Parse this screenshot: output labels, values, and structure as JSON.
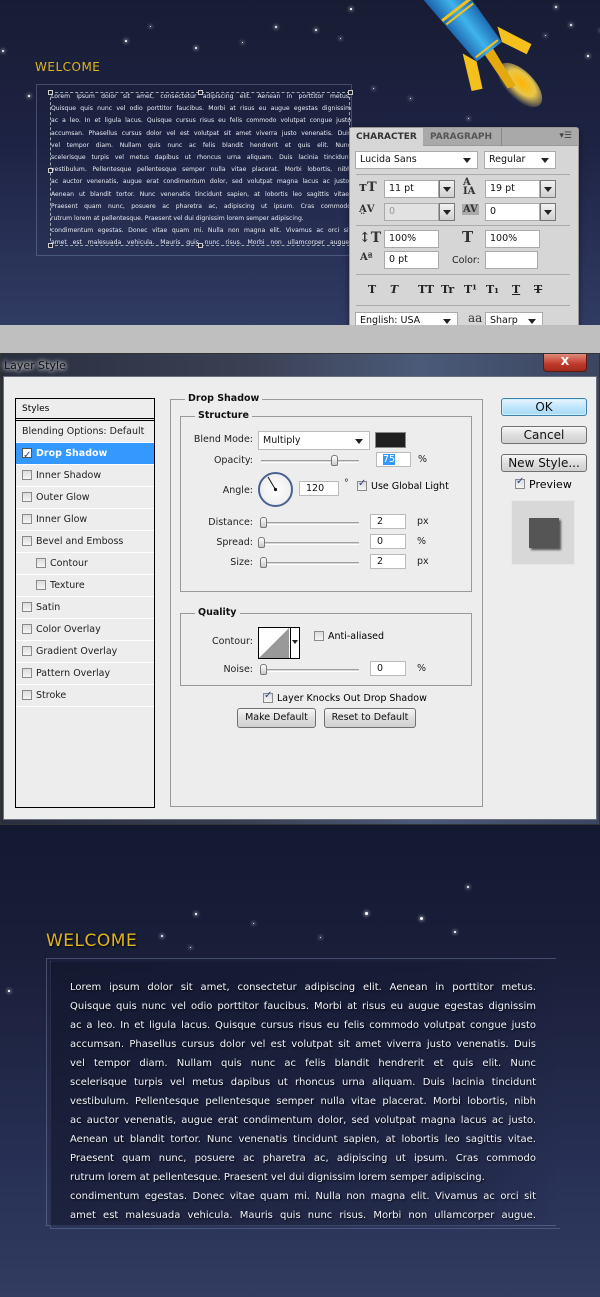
{
  "colors": {
    "welcome_gold": "#e0b321",
    "selection_blue": "#3399ff",
    "shadow_color": "#1f1f1f"
  },
  "top_preview": {
    "heading": "WELCOME",
    "paragraph_lines": [
      "Lorem ipsum dolor sit amet, consectetur adipiscing elit. Aenean in porttitor metus.",
      "Quisque quis nunc vel odio porttitor faucibus. Morbi at risus eu augue egestas dignissim",
      "ac a leo. In et ligula lacus. Quisque cursus risus eu felis commodo volutpat congue justo",
      "accumsan. Phasellus cursus dolor vel est volutpat sit amet viverra justo venenatis. Duis",
      "vel tempor diam. Nullam quis nunc ac felis blandit hendrerit et quis elit. Nunc",
      "scelerisque turpis vel metus dapibus ut rhoncus urna aliquam. Duis lacinia tincidunt",
      "vestibulum. Pellentesque pellentesque semper nulla vitae placerat. Morbi lobortis, nibh",
      "ac auctor venenatis, augue erat condimentum dolor, sed volutpat magna lacus ac justo.",
      "Aenean ut blandit tortor. Nunc venenatis tincidunt sapien, at lobortis leo sagittis vitae.",
      "Praesent quam nunc, posuere ac pharetra ac, adipiscing ut ipsum. Cras commodo",
      "rutrum lorem at pellentesque. Praesent vel dui dignissim lorem semper adipiscing.",
      "condimentum egestas. Donec vitae quam mi. Nulla non magna elit. Vivamus ac orci sit",
      "amet est malesuada vehicula. Mauris quis nunc risus. Morbi non ullamcorper augue."
    ]
  },
  "character_panel": {
    "tabs": [
      "CHARACTER",
      "PARAGRAPH"
    ],
    "menu_icon": "panel-menu-icon",
    "font_family": "Lucida Sans",
    "font_style": "Regular",
    "font_size": "11 pt",
    "leading": "19 pt",
    "kerning": "0",
    "tracking": "0",
    "vertical_scale": "100%",
    "horizontal_scale": "100%",
    "baseline_shift": "0 pt",
    "color_label": "Color:",
    "style_buttons": [
      "T",
      "T",
      "TT",
      "Tr",
      "T¹",
      "T₁",
      "T",
      "T"
    ],
    "language": "English: USA",
    "antialias_icon": "aa",
    "antialias": "Sharp"
  },
  "dialog": {
    "title": "Layer Style",
    "close_label": "X",
    "styles_header": "Styles",
    "styles": [
      {
        "label": "Blending Options: Default",
        "checkbox": false,
        "checked": false,
        "selected": false,
        "indent": false
      },
      {
        "label": "Drop Shadow",
        "checkbox": true,
        "checked": true,
        "selected": true,
        "indent": false
      },
      {
        "label": "Inner Shadow",
        "checkbox": true,
        "checked": false,
        "selected": false,
        "indent": false
      },
      {
        "label": "Outer Glow",
        "checkbox": true,
        "checked": false,
        "selected": false,
        "indent": false
      },
      {
        "label": "Inner Glow",
        "checkbox": true,
        "checked": false,
        "selected": false,
        "indent": false
      },
      {
        "label": "Bevel and Emboss",
        "checkbox": true,
        "checked": false,
        "selected": false,
        "indent": false
      },
      {
        "label": "Contour",
        "checkbox": true,
        "checked": false,
        "selected": false,
        "indent": true
      },
      {
        "label": "Texture",
        "checkbox": true,
        "checked": false,
        "selected": false,
        "indent": true
      },
      {
        "label": "Satin",
        "checkbox": true,
        "checked": false,
        "selected": false,
        "indent": false
      },
      {
        "label": "Color Overlay",
        "checkbox": true,
        "checked": false,
        "selected": false,
        "indent": false
      },
      {
        "label": "Gradient Overlay",
        "checkbox": true,
        "checked": false,
        "selected": false,
        "indent": false
      },
      {
        "label": "Pattern Overlay",
        "checkbox": true,
        "checked": false,
        "selected": false,
        "indent": false
      },
      {
        "label": "Stroke",
        "checkbox": true,
        "checked": false,
        "selected": false,
        "indent": false
      }
    ],
    "drop_shadow": {
      "section_title": "Drop Shadow",
      "structure_title": "Structure",
      "blend_mode_label": "Blend Mode:",
      "blend_mode": "Multiply",
      "opacity_label": "Opacity:",
      "opacity": "75",
      "opacity_unit": "%",
      "opacity_slider_fraction": 0.75,
      "angle_label": "Angle:",
      "angle": "120",
      "angle_unit": "°",
      "use_global_light_label": "Use Global Light",
      "use_global_light": true,
      "distance_label": "Distance:",
      "distance": "2",
      "distance_unit": "px",
      "spread_label": "Spread:",
      "spread": "0",
      "spread_unit": "%",
      "size_label": "Size:",
      "size": "2",
      "size_unit": "px",
      "quality_title": "Quality",
      "contour_label": "Contour:",
      "anti_aliased_label": "Anti-aliased",
      "anti_aliased": false,
      "noise_label": "Noise:",
      "noise": "0",
      "noise_unit": "%",
      "knockout_label": "Layer Knocks Out Drop Shadow",
      "knockout": true,
      "make_default_label": "Make Default",
      "reset_default_label": "Reset to Default"
    },
    "buttons": {
      "ok": "OK",
      "cancel": "Cancel",
      "new_style": "New Style..."
    },
    "preview_label": "Preview",
    "preview_checked": true
  },
  "bottom_result": {
    "heading": "WELCOME",
    "paragraph_lines": [
      "Lorem ipsum dolor sit amet, consectetur adipiscing elit. Aenean in porttitor metus.",
      "Quisque quis nunc vel odio porttitor faucibus. Morbi at risus eu augue egestas dignissim",
      "ac a leo. In et ligula lacus. Quisque cursus risus eu felis commodo volutpat congue justo",
      "accumsan. Phasellus cursus dolor vel est volutpat sit amet viverra justo venenatis. Duis",
      "vel tempor diam. Nullam quis nunc ac felis blandit hendrerit et quis elit. Nunc",
      "scelerisque turpis vel metus dapibus ut rhoncus urna aliquam. Duis lacinia tincidunt",
      "vestibulum. Pellentesque pellentesque semper nulla vitae placerat. Morbi lobortis, nibh",
      "ac auctor venenatis, augue erat condimentum dolor, sed volutpat magna lacus ac justo.",
      "Aenean ut blandit tortor. Nunc venenatis tincidunt sapien, at lobortis leo sagittis vitae.",
      "Praesent quam nunc, posuere ac pharetra ac, adipiscing ut ipsum. Cras commodo",
      "rutrum lorem at pellentesque. Praesent vel dui dignissim lorem semper adipiscing.",
      "condimentum egestas. Donec vitae quam mi. Nulla non magna elit. Vivamus ac orci sit",
      "amet est malesuada vehicula. Mauris quis nunc risus. Morbi non ullamcorper augue."
    ]
  }
}
